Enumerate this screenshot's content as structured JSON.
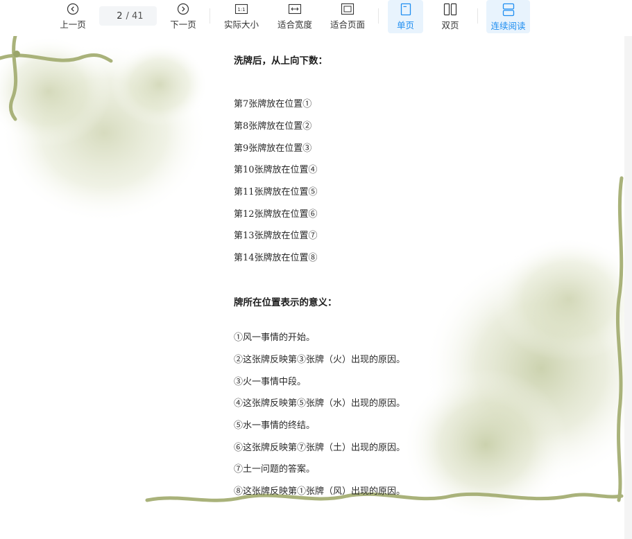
{
  "toolbar": {
    "prev_label": "上一页",
    "next_label": "下一页",
    "current_page": "2",
    "total_pages": "/ 41",
    "actual_size_label": "实际大小",
    "fit_width_label": "适合宽度",
    "fit_page_label": "适合页面",
    "single_page_label": "单页",
    "double_page_label": "双页",
    "continuous_label": "连续阅读",
    "actual_size_icon_text": "1:1",
    "accent_color": "#1f8ef1"
  },
  "document": {
    "heading1": "洗牌后，从上向下数：",
    "positions": [
      "第7张牌放在位置①",
      "第8张牌放在位置②",
      "第9张牌放在位置③",
      "第10张牌放在位置④",
      "第11张牌放在位置⑤",
      "第12张牌放在位置⑥",
      "第13张牌放在位置⑦",
      "第14张牌放在位置⑧"
    ],
    "heading2": "牌所在位置表示的意义：",
    "meanings": [
      "①风一事情的开始。",
      "②这张牌反映第③张牌（火）出现的原因。",
      "③火一事情中段。",
      "④这张牌反映第⑤张牌（水）出现的原因。",
      "⑤水一事情的终结。",
      "⑥这张牌反映第⑦张牌（土）出现的原因。",
      "⑦土一问题的答案。",
      "⑧这张牌反映第①张牌（风）出现的原因。"
    ]
  }
}
